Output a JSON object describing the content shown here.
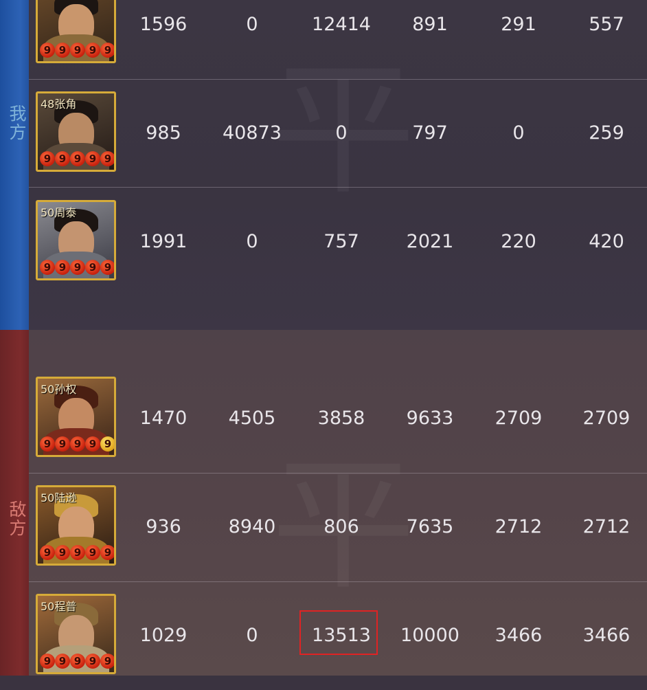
{
  "sides": {
    "ours_label": "我方",
    "enemy_label": "敌方",
    "watermark": "平"
  },
  "colors": {
    "ours_accent": "#2d62b5",
    "enemy_accent": "#7d2b2c",
    "highlight": "#e02323",
    "frame": "#d6ab39"
  },
  "ours": [
    {
      "level_name": "",
      "stars": [
        "9",
        "9",
        "9",
        "9",
        "9"
      ],
      "values": [
        "1596",
        "0",
        "12414",
        "891",
        "291",
        "557"
      ]
    },
    {
      "level_name": "48张角",
      "stars": [
        "9",
        "9",
        "9",
        "9",
        "9"
      ],
      "values": [
        "985",
        "40873",
        "0",
        "797",
        "0",
        "259"
      ]
    },
    {
      "level_name": "50周泰",
      "stars": [
        "9",
        "9",
        "9",
        "9",
        "9"
      ],
      "values": [
        "1991",
        "0",
        "757",
        "2021",
        "220",
        "420"
      ]
    }
  ],
  "enemy": [
    {
      "level_name": "50孙权",
      "stars": [
        "9",
        "9",
        "9",
        "9",
        "9"
      ],
      "values": [
        "1470",
        "4505",
        "3858",
        "9633",
        "2709",
        "2709"
      ]
    },
    {
      "level_name": "50陆逊",
      "stars": [
        "9",
        "9",
        "9",
        "9",
        "9"
      ],
      "values": [
        "936",
        "8940",
        "806",
        "7635",
        "2712",
        "2712"
      ]
    },
    {
      "level_name": "50程普",
      "stars": [
        "9",
        "9",
        "9",
        "9",
        "9"
      ],
      "values": [
        "1029",
        "0",
        "13513",
        "10000",
        "3466",
        "3466"
      ]
    }
  ],
  "highlighted_value": "13513"
}
